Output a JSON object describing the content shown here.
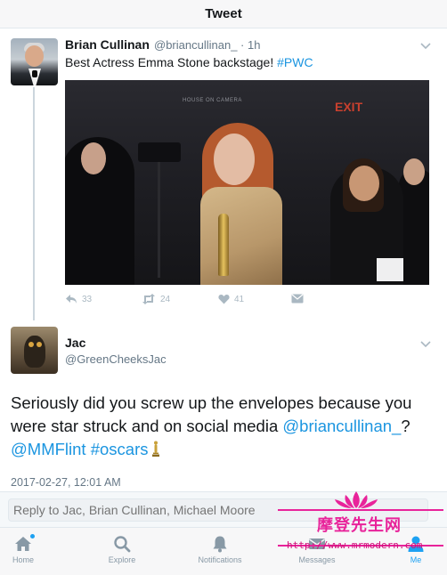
{
  "header": {
    "title": "Tweet"
  },
  "tweet1": {
    "author_name": "Brian Cullinan",
    "handle_time": "@briancullinan_ · 1h",
    "text_plain": "Best Actress Emma Stone backstage! ",
    "hashtag": "#PWC",
    "photo": {
      "sign": "HOUSE ON CAMERA",
      "exit": "EXIT"
    },
    "actions": {
      "reply_count": "33",
      "retweet_count": "24",
      "like_count": "41"
    }
  },
  "tweet2": {
    "author_name": "Jac",
    "handle": "@GreenCheeksJac",
    "text_part1": "Seriously did you screw up the envelopes because you were star struck and on social media ",
    "mention1": "@briancullinan_",
    "text_part2": "? ",
    "mention2": "@MMFlint",
    "text_part3": " ",
    "hashtag": "#oscars",
    "timestamp": "2017-02-27, 12:01 AM"
  },
  "reply": {
    "placeholder": "Reply to Jac, Brian Cullinan, Michael Moore"
  },
  "tabbar": {
    "items": [
      {
        "label": "Home",
        "icon": "home-icon"
      },
      {
        "label": "Explore",
        "icon": "search-icon"
      },
      {
        "label": "Notifications",
        "icon": "bell-icon"
      },
      {
        "label": "Messages",
        "icon": "mail-icon"
      },
      {
        "label": "Me",
        "icon": "person-icon"
      }
    ]
  },
  "watermark": {
    "title": "摩登先生网",
    "url": "http://www.mrmodern.com"
  },
  "colors": {
    "link": "#1b95e0",
    "accent": "#1da1f2",
    "watermark": "#e8239a"
  }
}
